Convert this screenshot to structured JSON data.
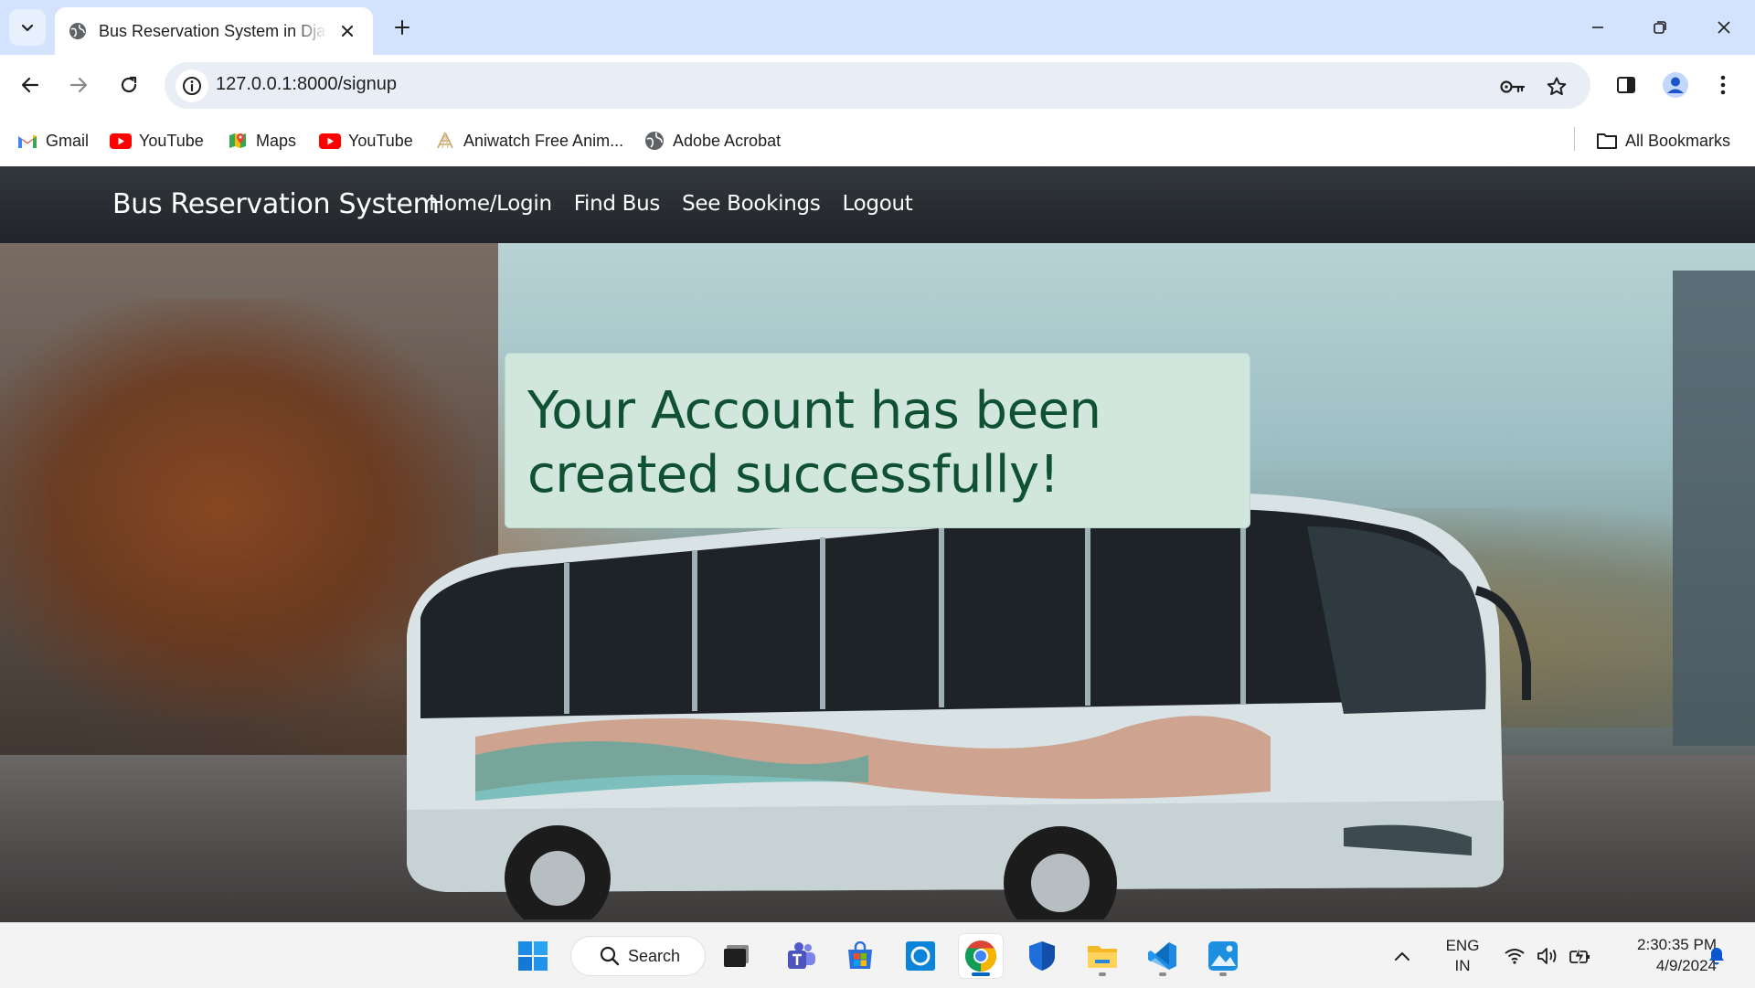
{
  "browser": {
    "tab_title": "Bus Reservation System in Django",
    "url": "127.0.0.1:8000/signup",
    "bookmarks": [
      {
        "label": "Gmail",
        "icon": "gmail-icon"
      },
      {
        "label": "YouTube",
        "icon": "youtube-icon"
      },
      {
        "label": "Maps",
        "icon": "maps-icon"
      },
      {
        "label": "YouTube",
        "icon": "youtube-icon"
      },
      {
        "label": "Aniwatch Free Anim...",
        "icon": "aniwatch-icon"
      },
      {
        "label": "Adobe Acrobat",
        "icon": "globe-icon"
      }
    ],
    "all_bookmarks": "All Bookmarks"
  },
  "page": {
    "brand": "Bus Reservation System",
    "nav": [
      "Home/Login",
      "Find Bus",
      "See Bookings",
      "Logout"
    ],
    "alert_message": "Your Account has been created successfully!",
    "colors": {
      "navbar": "#212529",
      "alert_bg": "#d1e7dd",
      "alert_text": "#0f5132"
    }
  },
  "taskbar": {
    "search_label": "Search",
    "apps": [
      "start-icon",
      "search-icon",
      "task-view-icon",
      "teams-icon",
      "store-icon",
      "cortana-icon",
      "chrome-icon",
      "defender-icon",
      "file-explorer-icon",
      "vscode-icon",
      "photos-icon"
    ],
    "language": "ENG",
    "region": "IN",
    "time": "2:30:35 PM",
    "date": "4/9/2024"
  }
}
